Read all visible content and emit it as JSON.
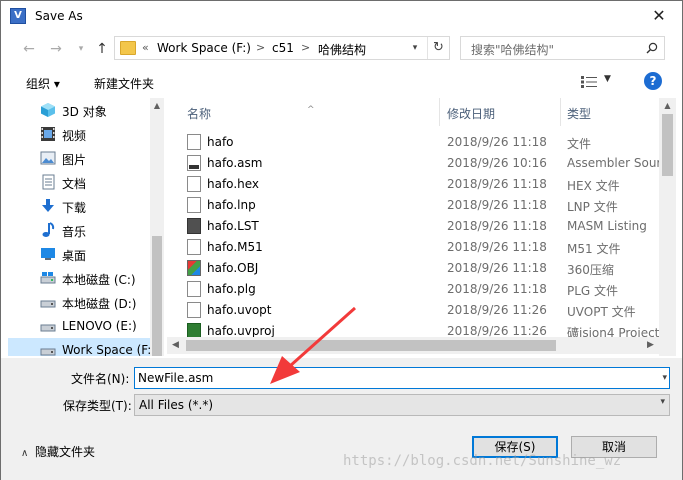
{
  "window": {
    "title": "Save As",
    "app_icon": "V"
  },
  "address": {
    "crumbs": [
      "Work Space (F:)",
      "c51",
      "哈佛结构"
    ],
    "prefix": "«",
    "separator": ">"
  },
  "search": {
    "placeholder": "搜索\"哈佛结构\""
  },
  "toolbar": {
    "organize": "组织 ▾",
    "new_folder": "新建文件夹",
    "help": "?"
  },
  "nav": {
    "items": [
      {
        "label": "3D 对象",
        "icon": "3d-objects-icon"
      },
      {
        "label": "视频",
        "icon": "video-icon"
      },
      {
        "label": "图片",
        "icon": "pictures-icon"
      },
      {
        "label": "文档",
        "icon": "documents-icon"
      },
      {
        "label": "下载",
        "icon": "download-icon"
      },
      {
        "label": "音乐",
        "icon": "music-icon"
      },
      {
        "label": "桌面",
        "icon": "desktop-icon"
      },
      {
        "label": "本地磁盘 (C:)",
        "icon": "drive-icon"
      },
      {
        "label": "本地磁盘 (D:)",
        "icon": "drive-icon"
      },
      {
        "label": "LENOVO (E:)",
        "icon": "drive-icon"
      },
      {
        "label": "Work Space (F:",
        "icon": "drive-icon"
      }
    ]
  },
  "columns": {
    "name": "名称",
    "date": "修改日期",
    "type": "类型"
  },
  "files": [
    {
      "name": "hafo",
      "date": "2018/9/26 11:18",
      "type": "文件",
      "icon": "blank-file-icon"
    },
    {
      "name": "hafo.asm",
      "date": "2018/9/26 10:16",
      "type": "Assembler Sour",
      "icon": "asm-file-icon"
    },
    {
      "name": "hafo.hex",
      "date": "2018/9/26 11:18",
      "type": "HEX 文件",
      "icon": "blank-file-icon"
    },
    {
      "name": "hafo.lnp",
      "date": "2018/9/26 11:18",
      "type": "LNP 文件",
      "icon": "blank-file-icon"
    },
    {
      "name": "hafo.LST",
      "date": "2018/9/26 11:18",
      "type": "MASM Listing",
      "icon": "listing-file-icon"
    },
    {
      "name": "hafo.M51",
      "date": "2018/9/26 11:18",
      "type": "M51 文件",
      "icon": "blank-file-icon"
    },
    {
      "name": "hafo.OBJ",
      "date": "2018/9/26 11:18",
      "type": "360压缩",
      "icon": "archive-file-icon"
    },
    {
      "name": "hafo.plg",
      "date": "2018/9/26 11:18",
      "type": "PLG 文件",
      "icon": "blank-file-icon"
    },
    {
      "name": "hafo.uvopt",
      "date": "2018/9/26 11:26",
      "type": "UVOPT 文件",
      "icon": "blank-file-icon"
    },
    {
      "name": "hafo.uvproj",
      "date": "2018/9/26 11:26",
      "type": "礦ision4 Project",
      "icon": "uvision-project-icon"
    }
  ],
  "form": {
    "filename_label": "文件名(N):",
    "filename_value": "NewFile.asm",
    "type_label": "保存类型(T):",
    "type_value": "All Files (*.*)",
    "hide_folders": "隐藏文件夹",
    "save": "保存(S)",
    "cancel": "取消"
  },
  "watermark": "https://blog.csdn.net/Sunshine_wz"
}
